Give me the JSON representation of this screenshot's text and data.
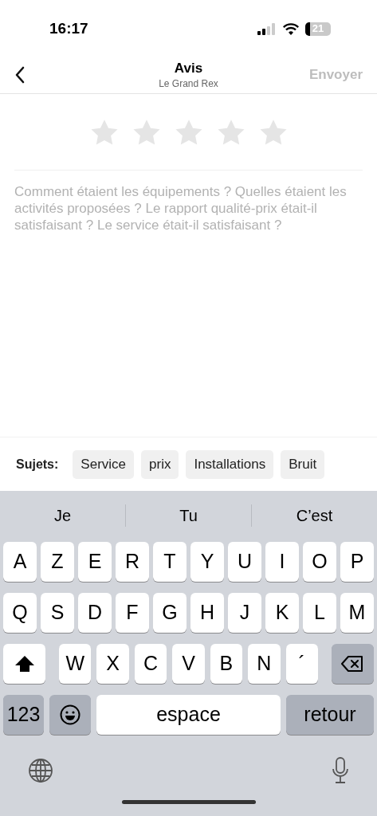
{
  "status_bar": {
    "time": "16:17",
    "battery": "21"
  },
  "header": {
    "title": "Avis",
    "subtitle": "Le Grand Rex",
    "send_button": {
      "label": "Envoyer",
      "disabled": true
    }
  },
  "rating": {
    "stars": 0
  },
  "review_field": {
    "placeholder": "Comment étaient les équipements ? Quelles étaient les activités proposées ? Le rapport qualité-prix était-il satisfaisant ? Le service était-il satisfaisant ?"
  },
  "topics": {
    "label": "Sujets:",
    "chips": [
      "Service",
      "prix",
      "Installations",
      "Bruit"
    ]
  },
  "keyboard": {
    "suggestions": [
      "Je",
      "Tu",
      "C’est"
    ],
    "rows": [
      [
        "A",
        "Z",
        "E",
        "R",
        "T",
        "Y",
        "U",
        "I",
        "O",
        "P"
      ],
      [
        "Q",
        "S",
        "D",
        "F",
        "G",
        "H",
        "J",
        "K",
        "L",
        "M"
      ],
      [
        "W",
        "X",
        "C",
        "V",
        "B",
        "N",
        "´"
      ]
    ],
    "numbers_key": "123",
    "space_key": "espace",
    "return_key": "retour"
  }
}
